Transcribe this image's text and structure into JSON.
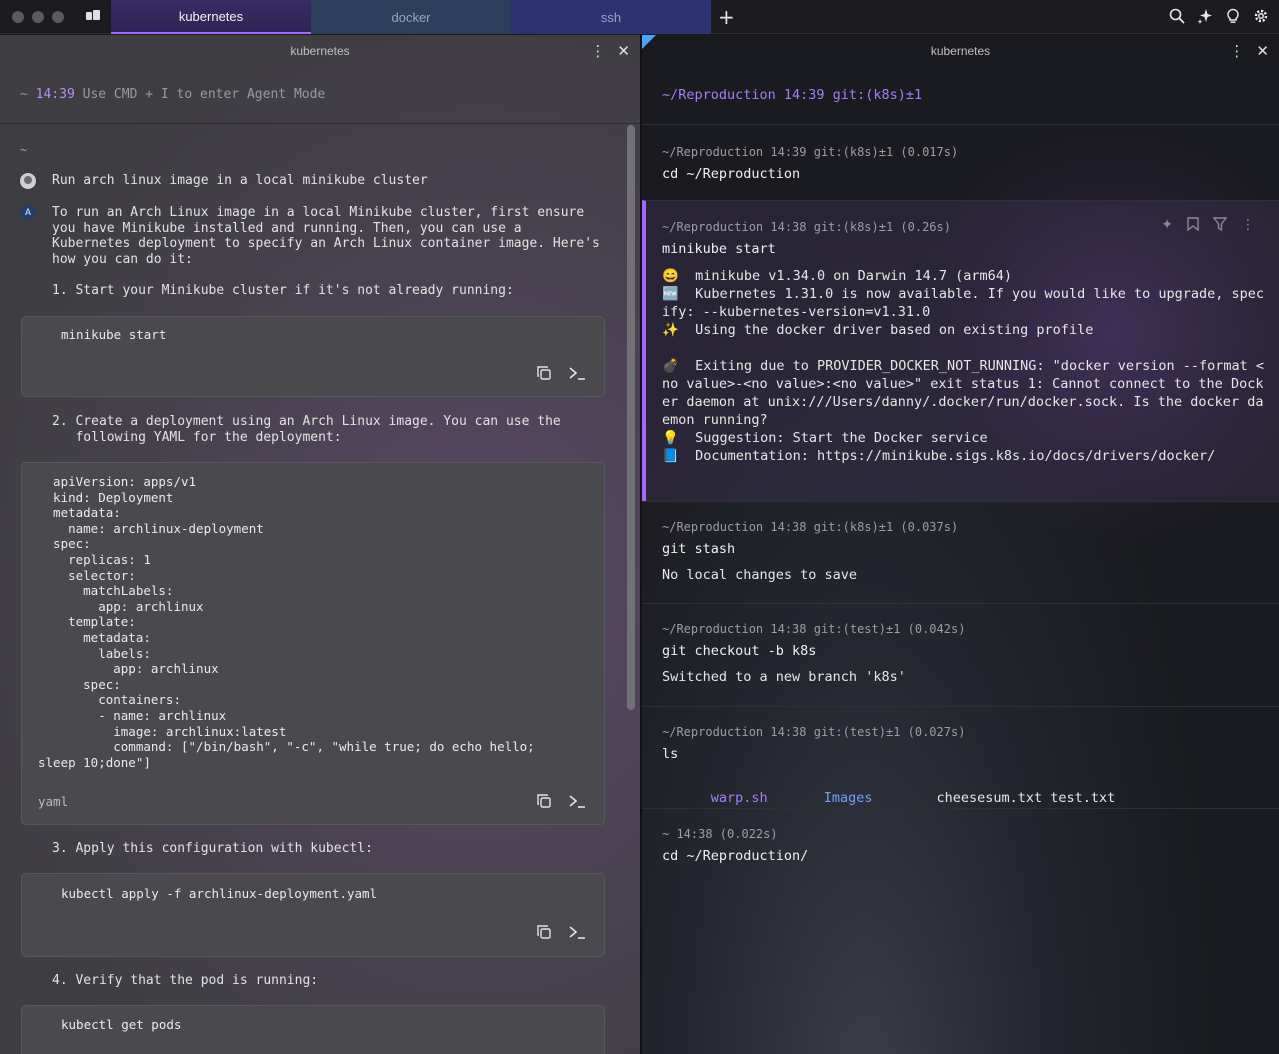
{
  "tabs": [
    {
      "label": "kubernetes",
      "active": true
    },
    {
      "label": "docker",
      "active": false
    },
    {
      "label": "ssh",
      "active": false
    }
  ],
  "titlebar_icons": [
    "search-icon",
    "sparkle-icon",
    "lightbulb-icon",
    "gear-icon"
  ],
  "left_pane": {
    "title": "kubernetes",
    "prompt": {
      "path": "~",
      "time": "14:39",
      "hint": "Use CMD + I to enter Agent Mode"
    },
    "tilde": "~",
    "user_message": "Run arch linux image in a local minikube cluster",
    "ai_intro": "To run an Arch Linux image in a local Minikube cluster, first ensure\nyou have Minikube installed and running. Then, you can use a\nKubernetes deployment to specify an Arch Linux container image. Here's\nhow you can do it:",
    "step1": "1. Start your Minikube cluster if it's not already running:",
    "code1": "minikube start",
    "step2": "2. Create a deployment using an Arch Linux image. You can use the\n   following YAML for the deployment:",
    "code2": "  apiVersion: apps/v1\n  kind: Deployment\n  metadata:\n    name: archlinux-deployment\n  spec:\n    replicas: 1\n    selector:\n      matchLabels:\n        app: archlinux\n    template:\n      metadata:\n        labels:\n          app: archlinux\n      spec:\n        containers:\n        - name: archlinux\n          image: archlinux:latest\n          command: [\"/bin/bash\", \"-c\", \"while true; do echo hello;\nsleep 10;done\"]",
    "code2_lang": "yaml",
    "step3": "3. Apply this configuration with kubectl:",
    "code3": "kubectl apply -f archlinux-deployment.yaml",
    "step4": "4. Verify that the pod is running:",
    "code4": "kubectl get pods"
  },
  "right_pane": {
    "title": "kubernetes",
    "prompt": "~/Reproduction 14:39 git:(k8s)±1",
    "blocks": [
      {
        "meta": "~/Reproduction 14:39 git:(k8s)±1 (0.017s)",
        "cmd": "cd ~/Reproduction",
        "output": ""
      },
      {
        "meta": "~/Reproduction 14:38 git:(k8s)±1 (0.26s)",
        "cmd": "minikube start",
        "output": "😄  minikube v1.34.0 on Darwin 14.7 (arm64)\n🆕  Kubernetes 1.31.0 is now available. If you would like to upgrade, spec\nify: --kubernetes-version=v1.31.0\n✨  Using the docker driver based on existing profile\n\n💣  Exiting due to PROVIDER_DOCKER_NOT_RUNNING: \"docker version --format <\nno value>-<no value>:<no value>\" exit status 1: Cannot connect to the Dock\ner daemon at unix:///Users/danny/.docker/run/docker.sock. Is the docker da\nemon running?\n💡  Suggestion: Start the Docker service\n📘  Documentation: https://minikube.sigs.k8s.io/docs/drivers/docker/"
      },
      {
        "meta": "~/Reproduction 14:38 git:(k8s)±1 (0.037s)",
        "cmd": "git stash",
        "output": "No local changes to save"
      },
      {
        "meta": "~/Reproduction 14:38 git:(test)±1 (0.042s)",
        "cmd": "git checkout -b k8s",
        "output": "Switched to a new branch 'k8s'"
      },
      {
        "meta": "~/Reproduction 14:38 git:(test)±1 (0.027s)",
        "cmd": "ls",
        "output": ""
      },
      {
        "meta": "~ 14:38 (0.022s)",
        "cmd": "cd ~/Reproduction/",
        "output": ""
      }
    ],
    "ls_items": [
      "warp.sh",
      "Images",
      "cheesesum.txt",
      "test.txt"
    ]
  }
}
